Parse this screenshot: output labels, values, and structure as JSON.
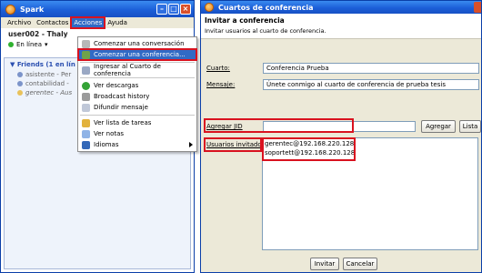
{
  "spark": {
    "title": "Spark",
    "menus": [
      "Archivo",
      "Contactos",
      "Acciones",
      "Ayuda"
    ],
    "username": "user002 - Thaly",
    "status": "En línea",
    "group": "Friends (1 en lín",
    "contacts": [
      {
        "name": "asistente - Per"
      },
      {
        "name": "contabilidad - "
      },
      {
        "name": "gerentec - Aus"
      }
    ],
    "dropdown": [
      {
        "label": "Comenzar una conversación"
      },
      {
        "label": "Comenzar una conferencia..."
      },
      {
        "label": "Ingresar al Cuarto de conferencia"
      },
      {
        "label": "Ver descargas"
      },
      {
        "label": "Broadcast history"
      },
      {
        "label": "Difundir mensaje"
      },
      {
        "label": "Ver lista de tareas"
      },
      {
        "label": "Ver notas"
      },
      {
        "label": "Idiomas"
      }
    ],
    "colors": {
      "highlight": "#316ac5",
      "callout": "#d9121f"
    }
  },
  "conference": {
    "title": "Cuartos de conferencia",
    "heading": "Invitar a conferencia",
    "subheading": "Invitar usuarios al cuarto de conferencia.",
    "room_label": "Cuarto:",
    "room_value": "Conferencia Prueba",
    "message_label": "Mensaje:",
    "message_value": "Únete conmigo al cuarto de conferencia de prueba tesis",
    "jid_label": "Agregar JID",
    "jid_value": "",
    "add_button": "Agregar",
    "list_button": "Lista",
    "invited_label": "Usuarios invitados",
    "invited": [
      "gerentec@192.168.220.128",
      "soportett@192.168.220.128"
    ],
    "invite_button": "Invitar",
    "cancel_button": "Cancelar"
  }
}
